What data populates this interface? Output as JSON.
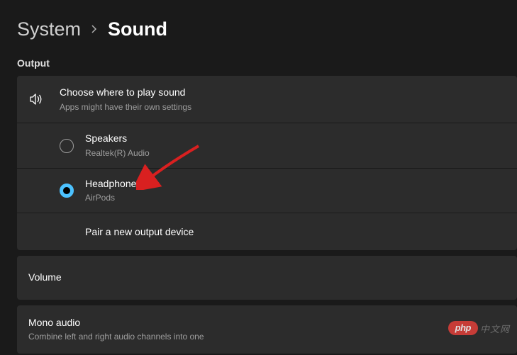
{
  "breadcrumb": {
    "parent": "System",
    "current": "Sound"
  },
  "output": {
    "section_label": "Output",
    "choose": {
      "title": "Choose where to play sound",
      "subtitle": "Apps might have their own settings"
    },
    "devices": [
      {
        "name": "Speakers",
        "detail": "Realtek(R) Audio",
        "selected": false
      },
      {
        "name": "Headphones",
        "detail": "AirPods",
        "selected": true
      }
    ],
    "pair_label": "Pair a new output device"
  },
  "volume": {
    "label": "Volume"
  },
  "mono": {
    "title": "Mono audio",
    "subtitle": "Combine left and right audio channels into one"
  },
  "watermark": {
    "brand": "php",
    "text": "中文网"
  }
}
